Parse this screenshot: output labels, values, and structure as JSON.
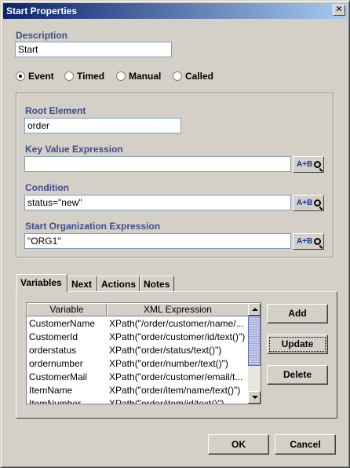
{
  "window": {
    "title": "Start Properties",
    "close_glyph": "✕"
  },
  "description": {
    "label": "Description",
    "value": "Start"
  },
  "trigger": {
    "options": [
      {
        "label": "Event",
        "selected": true
      },
      {
        "label": "Timed",
        "selected": false
      },
      {
        "label": "Manual",
        "selected": false
      },
      {
        "label": "Called",
        "selected": false
      }
    ]
  },
  "root_element": {
    "label": "Root Element",
    "value": "order"
  },
  "key_value_expression": {
    "label": "Key Value Expression",
    "value": ""
  },
  "condition": {
    "label": "Condition",
    "value": "status=\"new\""
  },
  "start_org_expression": {
    "label": "Start Organization Expression",
    "value": "\"ORG1\""
  },
  "expression_button": {
    "label": "A+B",
    "icon": "magnifier-icon"
  },
  "tabs": [
    {
      "label": "Variables",
      "active": true
    },
    {
      "label": "Next",
      "active": false
    },
    {
      "label": "Actions",
      "active": false
    },
    {
      "label": "Notes",
      "active": false
    }
  ],
  "variables_table": {
    "columns": [
      "Variable",
      "XML Expression"
    ],
    "rows": [
      {
        "variable": "CustomerName",
        "expression": "XPath(\"/order/customer/name/..."
      },
      {
        "variable": "CustomerId",
        "expression": "XPath(\"order/customer/id/text()\")"
      },
      {
        "variable": "orderstatus",
        "expression": "XPath(\"order/status/text()\")"
      },
      {
        "variable": "ordernumber",
        "expression": "XPath(\"order/number/text()\")"
      },
      {
        "variable": "CustomerMail",
        "expression": "XPath(\"order/customer/email/t..."
      },
      {
        "variable": "ItemName",
        "expression": "XPath(\"order/item/name/text()\")"
      },
      {
        "variable": "ItemNumber",
        "expression": "XPath(\"order/item/id/text()\")"
      }
    ]
  },
  "side_buttons": {
    "add": "Add",
    "update": "Update",
    "delete": "Delete"
  },
  "footer": {
    "ok": "OK",
    "cancel": "Cancel"
  }
}
